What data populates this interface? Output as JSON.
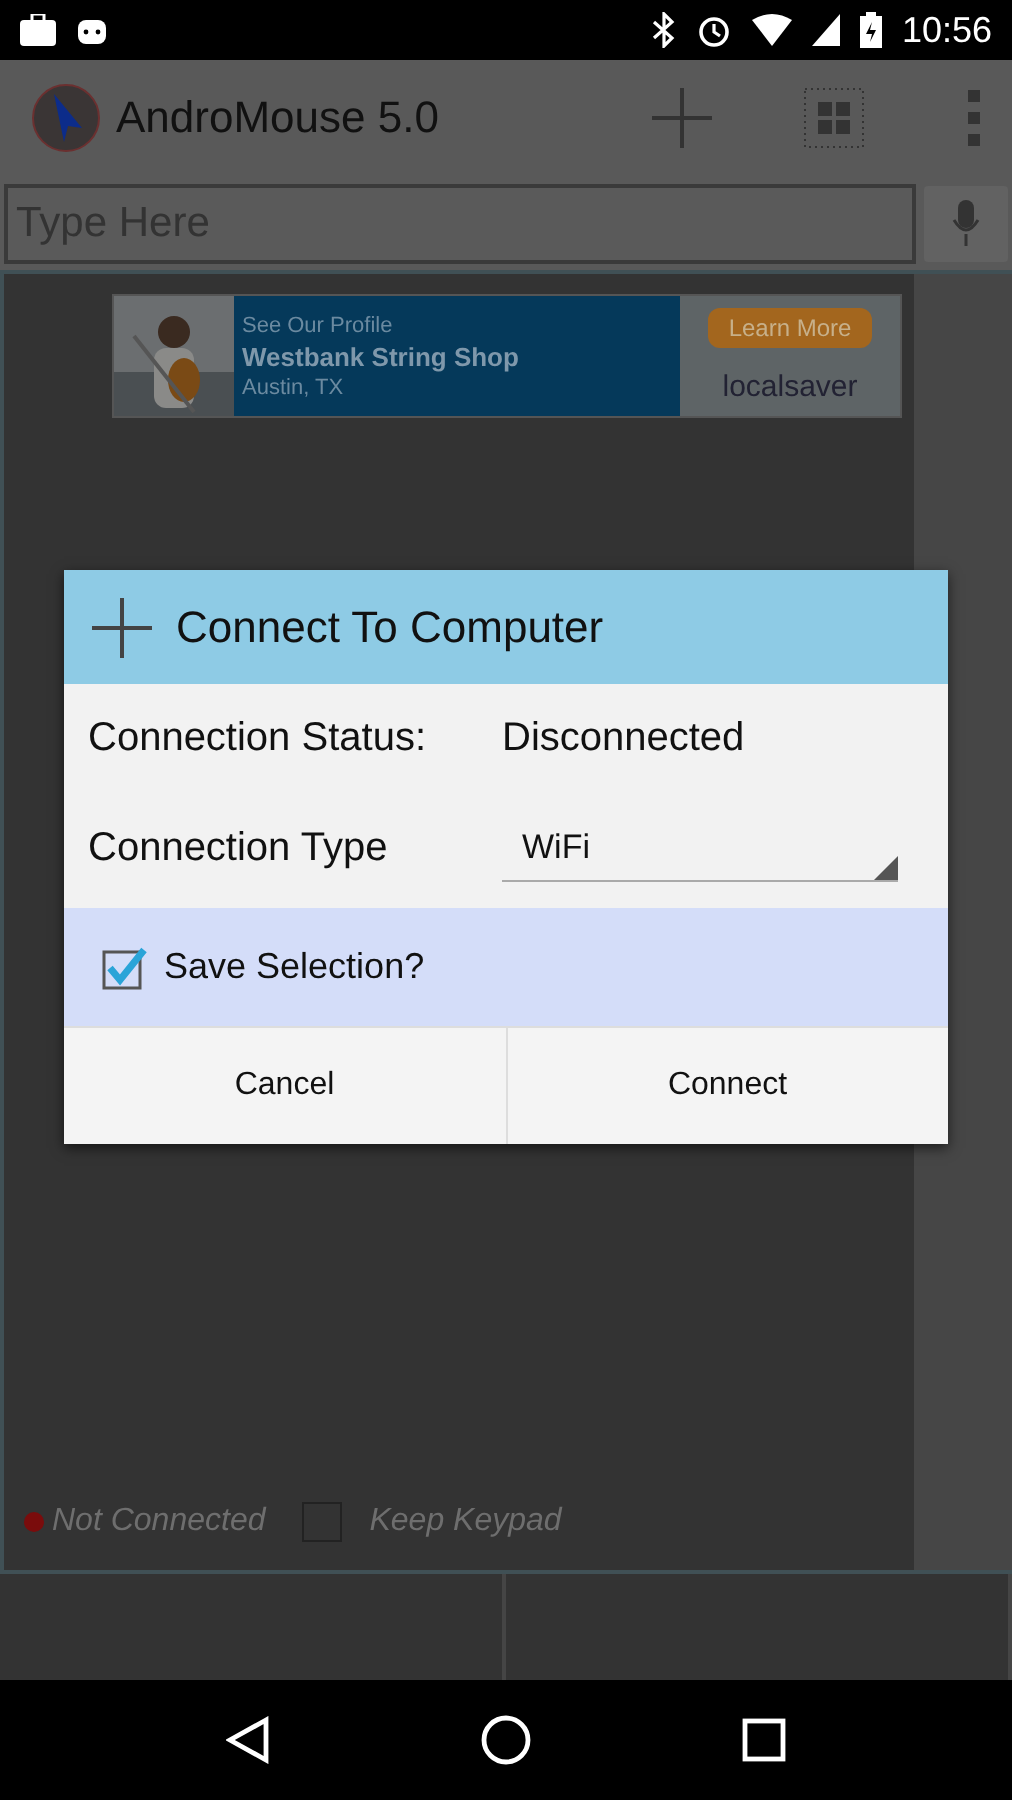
{
  "status_bar": {
    "time": "10:56"
  },
  "app_bar": {
    "title": "AndroMouse 5.0"
  },
  "input": {
    "placeholder": "Type Here"
  },
  "ad": {
    "tagline": "See Our Profile",
    "name": "Westbank String Shop",
    "location": "Austin, TX",
    "button": "Learn More",
    "brand": "localsaver"
  },
  "dialog": {
    "title": "Connect To Computer",
    "rows": [
      {
        "kind": "text",
        "label": "Connection Status:",
        "value": "Disconnected"
      },
      {
        "kind": "dropdown",
        "label": "Connection Type",
        "value": "WiFi"
      }
    ],
    "save": {
      "label": "Save Selection?",
      "checked": true
    },
    "buttons": [
      "Cancel",
      "Connect"
    ]
  },
  "footer": {
    "status": {
      "label": "Not Connected",
      "color": "#7a0c0c"
    },
    "keep_keypad": {
      "label": "Keep Keypad",
      "checked": false
    }
  }
}
